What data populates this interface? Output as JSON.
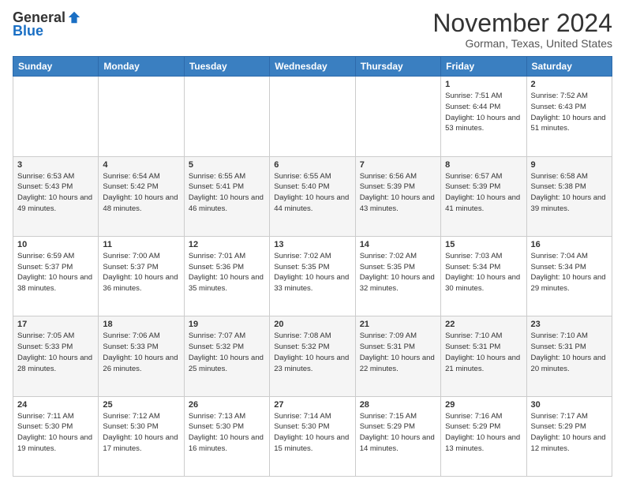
{
  "header": {
    "logo_general": "General",
    "logo_blue": "Blue",
    "month_title": "November 2024",
    "location": "Gorman, Texas, United States"
  },
  "days_of_week": [
    "Sunday",
    "Monday",
    "Tuesday",
    "Wednesday",
    "Thursday",
    "Friday",
    "Saturday"
  ],
  "weeks": [
    [
      {
        "day": "",
        "info": ""
      },
      {
        "day": "",
        "info": ""
      },
      {
        "day": "",
        "info": ""
      },
      {
        "day": "",
        "info": ""
      },
      {
        "day": "",
        "info": ""
      },
      {
        "day": "1",
        "info": "Sunrise: 7:51 AM\nSunset: 6:44 PM\nDaylight: 10 hours\nand 53 minutes."
      },
      {
        "day": "2",
        "info": "Sunrise: 7:52 AM\nSunset: 6:43 PM\nDaylight: 10 hours\nand 51 minutes."
      }
    ],
    [
      {
        "day": "3",
        "info": "Sunrise: 6:53 AM\nSunset: 5:43 PM\nDaylight: 10 hours\nand 49 minutes."
      },
      {
        "day": "4",
        "info": "Sunrise: 6:54 AM\nSunset: 5:42 PM\nDaylight: 10 hours\nand 48 minutes."
      },
      {
        "day": "5",
        "info": "Sunrise: 6:55 AM\nSunset: 5:41 PM\nDaylight: 10 hours\nand 46 minutes."
      },
      {
        "day": "6",
        "info": "Sunrise: 6:55 AM\nSunset: 5:40 PM\nDaylight: 10 hours\nand 44 minutes."
      },
      {
        "day": "7",
        "info": "Sunrise: 6:56 AM\nSunset: 5:39 PM\nDaylight: 10 hours\nand 43 minutes."
      },
      {
        "day": "8",
        "info": "Sunrise: 6:57 AM\nSunset: 5:39 PM\nDaylight: 10 hours\nand 41 minutes."
      },
      {
        "day": "9",
        "info": "Sunrise: 6:58 AM\nSunset: 5:38 PM\nDaylight: 10 hours\nand 39 minutes."
      }
    ],
    [
      {
        "day": "10",
        "info": "Sunrise: 6:59 AM\nSunset: 5:37 PM\nDaylight: 10 hours\nand 38 minutes."
      },
      {
        "day": "11",
        "info": "Sunrise: 7:00 AM\nSunset: 5:37 PM\nDaylight: 10 hours\nand 36 minutes."
      },
      {
        "day": "12",
        "info": "Sunrise: 7:01 AM\nSunset: 5:36 PM\nDaylight: 10 hours\nand 35 minutes."
      },
      {
        "day": "13",
        "info": "Sunrise: 7:02 AM\nSunset: 5:35 PM\nDaylight: 10 hours\nand 33 minutes."
      },
      {
        "day": "14",
        "info": "Sunrise: 7:02 AM\nSunset: 5:35 PM\nDaylight: 10 hours\nand 32 minutes."
      },
      {
        "day": "15",
        "info": "Sunrise: 7:03 AM\nSunset: 5:34 PM\nDaylight: 10 hours\nand 30 minutes."
      },
      {
        "day": "16",
        "info": "Sunrise: 7:04 AM\nSunset: 5:34 PM\nDaylight: 10 hours\nand 29 minutes."
      }
    ],
    [
      {
        "day": "17",
        "info": "Sunrise: 7:05 AM\nSunset: 5:33 PM\nDaylight: 10 hours\nand 28 minutes."
      },
      {
        "day": "18",
        "info": "Sunrise: 7:06 AM\nSunset: 5:33 PM\nDaylight: 10 hours\nand 26 minutes."
      },
      {
        "day": "19",
        "info": "Sunrise: 7:07 AM\nSunset: 5:32 PM\nDaylight: 10 hours\nand 25 minutes."
      },
      {
        "day": "20",
        "info": "Sunrise: 7:08 AM\nSunset: 5:32 PM\nDaylight: 10 hours\nand 23 minutes."
      },
      {
        "day": "21",
        "info": "Sunrise: 7:09 AM\nSunset: 5:31 PM\nDaylight: 10 hours\nand 22 minutes."
      },
      {
        "day": "22",
        "info": "Sunrise: 7:10 AM\nSunset: 5:31 PM\nDaylight: 10 hours\nand 21 minutes."
      },
      {
        "day": "23",
        "info": "Sunrise: 7:10 AM\nSunset: 5:31 PM\nDaylight: 10 hours\nand 20 minutes."
      }
    ],
    [
      {
        "day": "24",
        "info": "Sunrise: 7:11 AM\nSunset: 5:30 PM\nDaylight: 10 hours\nand 19 minutes."
      },
      {
        "day": "25",
        "info": "Sunrise: 7:12 AM\nSunset: 5:30 PM\nDaylight: 10 hours\nand 17 minutes."
      },
      {
        "day": "26",
        "info": "Sunrise: 7:13 AM\nSunset: 5:30 PM\nDaylight: 10 hours\nand 16 minutes."
      },
      {
        "day": "27",
        "info": "Sunrise: 7:14 AM\nSunset: 5:30 PM\nDaylight: 10 hours\nand 15 minutes."
      },
      {
        "day": "28",
        "info": "Sunrise: 7:15 AM\nSunset: 5:29 PM\nDaylight: 10 hours\nand 14 minutes."
      },
      {
        "day": "29",
        "info": "Sunrise: 7:16 AM\nSunset: 5:29 PM\nDaylight: 10 hours\nand 13 minutes."
      },
      {
        "day": "30",
        "info": "Sunrise: 7:17 AM\nSunset: 5:29 PM\nDaylight: 10 hours\nand 12 minutes."
      }
    ]
  ]
}
